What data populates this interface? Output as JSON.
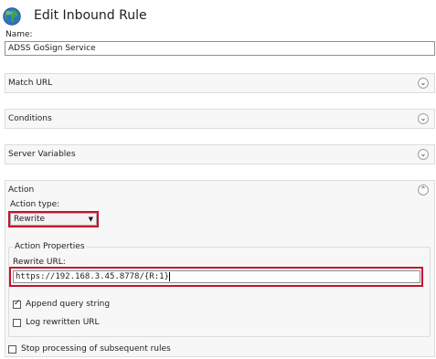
{
  "header": {
    "title": "Edit Inbound Rule",
    "icon": "globe-icon"
  },
  "name_field": {
    "label": "Name:",
    "value": "ADSS GoSign Service"
  },
  "sections": {
    "match_url": {
      "title": "Match URL",
      "expanded": false
    },
    "conditions": {
      "title": "Conditions",
      "expanded": false
    },
    "server_variables": {
      "title": "Server Variables",
      "expanded": false
    },
    "action": {
      "title": "Action",
      "expanded": true
    }
  },
  "action": {
    "type_label": "Action type:",
    "type_value": "Rewrite",
    "properties_legend": "Action Properties",
    "rewrite_url_label": "Rewrite URL:",
    "rewrite_url_value": "https://192.168.3.45.8778/{R:1}",
    "append_query_string": {
      "label": "Append query string",
      "checked": true
    },
    "log_rewritten_url": {
      "label": "Log rewritten URL",
      "checked": false
    }
  },
  "stop_processing": {
    "label": "Stop processing of subsequent rules",
    "checked": false
  },
  "colors": {
    "highlight": "#c8102e",
    "section_bg": "#f7f7f7",
    "border": "#dcdcdc"
  }
}
